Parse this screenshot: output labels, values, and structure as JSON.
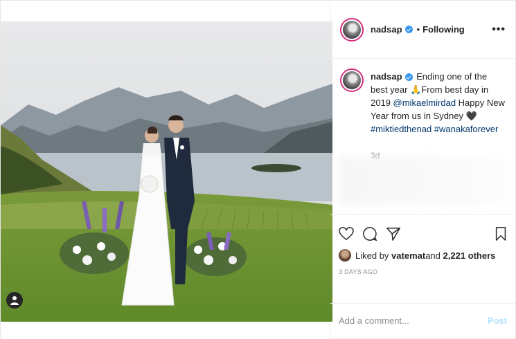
{
  "post": {
    "username": "nadsap",
    "follow_status": "Following",
    "separator": "•",
    "more_menu": "•••"
  },
  "caption": {
    "username": "nadsap",
    "line1": " Ending one of the best year",
    "emoji": "🙏",
    "line2": "From best day in 2019",
    "mention": "@mikaelmirdad",
    "line3": " Happy New Year from us in Sydney ",
    "heart": "🖤",
    "hashtag1": "#miktiedthenad",
    "hashtag2": "#wanakaforever",
    "time": "3d"
  },
  "likes": {
    "prefix": "Liked by ",
    "user": "vatemat",
    "mid": " and ",
    "count": "2,221 others"
  },
  "timestamp": "3 DAYS AGO",
  "comment_box": {
    "placeholder": "Add a comment...",
    "post_label": "Post"
  },
  "icons": {
    "like": "heart-icon",
    "comment": "comment-icon",
    "share": "share-icon",
    "save": "bookmark-icon",
    "tag": "user-tag-icon"
  },
  "colors": {
    "verified": "#3897f0",
    "link": "#00376b",
    "post_button": "#b2dffc"
  }
}
